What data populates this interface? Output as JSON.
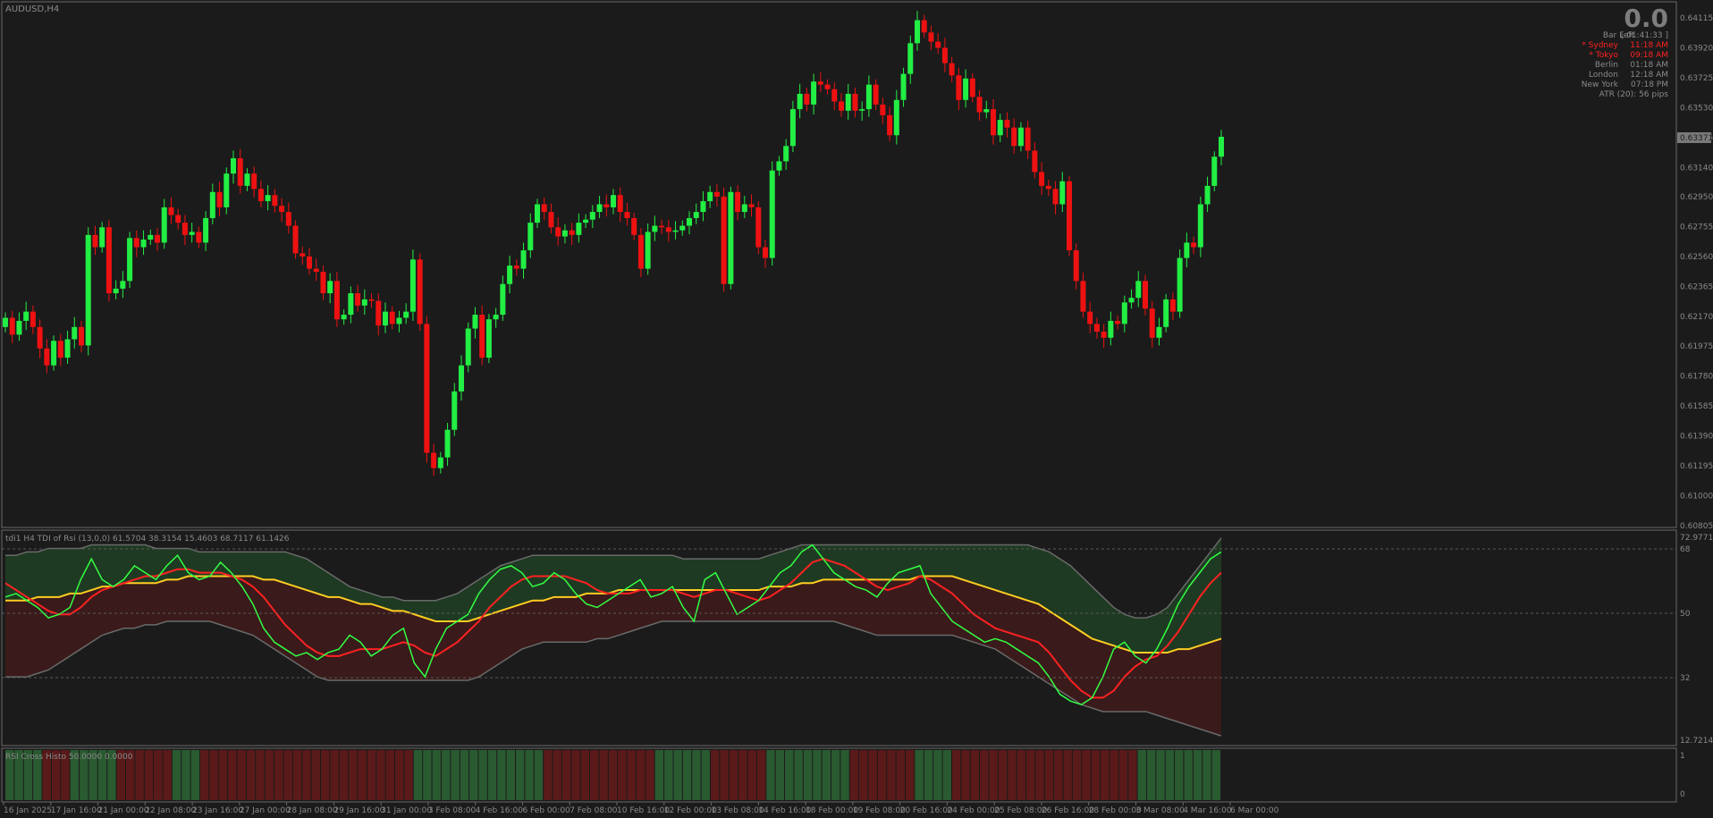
{
  "window": {
    "title": "AUDUSD,H4"
  },
  "colors": {
    "bull": "#22ee44",
    "bear": "#ee1111",
    "grid": "#5a5a5a",
    "text": "#8a8a8a",
    "background": "#1b1b1b"
  },
  "info_panel": {
    "value": "0.0",
    "rows": [
      {
        "label": "Bar Left",
        "value": "[ 01:41:33 ]",
        "highlight": false
      },
      {
        "label": "* Sydney",
        "value": "11:18 AM",
        "highlight": true
      },
      {
        "label": "* Tokyo",
        "value": "09:18 AM",
        "highlight": true
      },
      {
        "label": "Berlin",
        "value": "01:18 AM",
        "highlight": false
      },
      {
        "label": "London",
        "value": "12:18 AM",
        "highlight": false
      },
      {
        "label": "New York",
        "value": "07:18 PM",
        "highlight": false
      }
    ],
    "atr": "ATR (20): 56 pips"
  },
  "price_axis": {
    "ticks": [
      "0.64115",
      "0.63920",
      "0.63725",
      "0.63530",
      "0.63335",
      "0.63140",
      "0.62950",
      "0.62755",
      "0.62560",
      "0.62365",
      "0.62170",
      "0.61975",
      "0.61780",
      "0.61585",
      "0.61390",
      "0.61195",
      "0.61000",
      "0.60805"
    ],
    "current_price": "0.63371"
  },
  "tdi": {
    "title": "tdi1 H4 TDI of Rsi (13,0,0) 61.5704 38.3154 15.4603 68.7117 61.1426",
    "axis_labels": [
      "72.9771",
      "68",
      "50",
      "32",
      "12.7214"
    ]
  },
  "histo": {
    "title": "RSI Cross Histo 50.0000 0.0000",
    "axis_labels": [
      "1",
      "0"
    ]
  },
  "time_axis": [
    "16 Jan 2025",
    "17 Jan 16:00",
    "21 Jan 00:00",
    "22 Jan 08:00",
    "23 Jan 16:00",
    "27 Jan 00:00",
    "28 Jan 08:00",
    "29 Jan 16:00",
    "31 Jan 00:00",
    "3 Feb 08:00",
    "4 Feb 16:00",
    "6 Feb 00:00",
    "7 Feb 08:00",
    "10 Feb 16:00",
    "12 Feb 00:00",
    "13 Feb 08:00",
    "14 Feb 16:00",
    "18 Feb 00:00",
    "19 Feb 08:00",
    "20 Feb 16:00",
    "24 Feb 00:00",
    "25 Feb 08:00",
    "26 Feb 16:00",
    "28 Feb 00:00",
    "3 Mar 08:00",
    "4 Mar 16:00",
    "6 Mar 00:00"
  ],
  "chart_data": {
    "type": "candlestick",
    "symbol": "AUDUSD",
    "timeframe": "H4",
    "ylim": [
      0.60805,
      0.64115
    ],
    "closes": [
      0.6216,
      0.6205,
      0.6214,
      0.622,
      0.621,
      0.6196,
      0.6185,
      0.6201,
      0.619,
      0.6202,
      0.621,
      0.6198,
      0.627,
      0.6262,
      0.6275,
      0.6232,
      0.6235,
      0.624,
      0.6268,
      0.6262,
      0.6267,
      0.627,
      0.6265,
      0.6288,
      0.6283,
      0.6278,
      0.627,
      0.6272,
      0.6265,
      0.6281,
      0.6298,
      0.6288,
      0.631,
      0.632,
      0.6302,
      0.631,
      0.63,
      0.6292,
      0.6296,
      0.6289,
      0.6285,
      0.6276,
      0.6258,
      0.6256,
      0.6248,
      0.6246,
      0.6232,
      0.624,
      0.6215,
      0.6218,
      0.6232,
      0.6224,
      0.6228,
      0.6227,
      0.6211,
      0.622,
      0.6212,
      0.6216,
      0.622,
      0.6254,
      0.6212,
      0.6128,
      0.6118,
      0.6125,
      0.6143,
      0.6168,
      0.6185,
      0.6209,
      0.6218,
      0.619,
      0.6215,
      0.6218,
      0.6238,
      0.625,
      0.6248,
      0.626,
      0.6278,
      0.629,
      0.6285,
      0.6275,
      0.6269,
      0.6273,
      0.627,
      0.6278,
      0.628,
      0.6285,
      0.629,
      0.6288,
      0.6296,
      0.6285,
      0.6281,
      0.627,
      0.6248,
      0.6272,
      0.6276,
      0.6275,
      0.6272,
      0.6273,
      0.6276,
      0.6281,
      0.6285,
      0.6292,
      0.6298,
      0.6295,
      0.6238,
      0.6298,
      0.6285,
      0.629,
      0.6288,
      0.6262,
      0.6255,
      0.6312,
      0.6318,
      0.6328,
      0.6352,
      0.6362,
      0.6355,
      0.637,
      0.6368,
      0.6365,
      0.6357,
      0.6351,
      0.6362,
      0.6351,
      0.6352,
      0.6368,
      0.6355,
      0.6348,
      0.6335,
      0.6358,
      0.6375,
      0.6395,
      0.641,
      0.6402,
      0.6396,
      0.6392,
      0.6382,
      0.6374,
      0.6358,
      0.6372,
      0.636,
      0.635,
      0.6352,
      0.6335,
      0.6345,
      0.634,
      0.6328,
      0.634,
      0.6325,
      0.6311,
      0.6302,
      0.63,
      0.629,
      0.6305,
      0.626,
      0.624,
      0.622,
      0.6212,
      0.6207,
      0.6203,
      0.6214,
      0.6212,
      0.6226,
      0.6229,
      0.624,
      0.6222,
      0.6203,
      0.621,
      0.6228,
      0.622,
      0.6255,
      0.6265,
      0.6262,
      0.629,
      0.6302,
      0.6321,
      0.6334
    ],
    "tdi": {
      "rsi_price_line": [
        55,
        56,
        54,
        52,
        49,
        50,
        52,
        60,
        66,
        60,
        58,
        60,
        64,
        62,
        60,
        64,
        67,
        62,
        60,
        61,
        65,
        62,
        58,
        53,
        46,
        42,
        40,
        38,
        39,
        37,
        39,
        40,
        44,
        42,
        38,
        40,
        44,
        46,
        36,
        32,
        40,
        46,
        48,
        50,
        56,
        60,
        63,
        64,
        62,
        58,
        59,
        62,
        60,
        56,
        53,
        52,
        54,
        56,
        58,
        60,
        55,
        56,
        58,
        52,
        48,
        60,
        62,
        56,
        50,
        52,
        54,
        58,
        62,
        64,
        68,
        70,
        66,
        62,
        60,
        58,
        57,
        55,
        59,
        62,
        63,
        64,
        56,
        52,
        48,
        46,
        44,
        42,
        43,
        42,
        40,
        38,
        36,
        32,
        27,
        25,
        24,
        26,
        32,
        40,
        42,
        38,
        36,
        40,
        46,
        53,
        58,
        62,
        66,
        68
      ],
      "trade_signal_line": [
        59,
        57,
        55,
        53,
        51,
        50,
        50,
        52,
        55,
        57,
        58,
        59,
        60,
        61,
        61,
        62,
        63,
        63,
        62,
        62,
        62,
        61,
        60,
        58,
        55,
        51,
        47,
        44,
        41,
        39,
        38,
        38,
        39,
        40,
        40,
        40,
        41,
        42,
        41,
        39,
        38,
        40,
        42,
        45,
        48,
        52,
        55,
        58,
        60,
        61,
        61,
        61,
        61,
        60,
        59,
        57,
        56,
        56,
        56,
        57,
        57,
        57,
        57,
        56,
        55,
        56,
        57,
        57,
        56,
        55,
        54,
        55,
        57,
        59,
        62,
        65,
        66,
        65,
        64,
        62,
        60,
        58,
        57,
        58,
        59,
        61,
        60,
        58,
        56,
        53,
        50,
        48,
        46,
        45,
        44,
        43,
        42,
        39,
        35,
        31,
        28,
        26,
        26,
        28,
        32,
        35,
        37,
        38,
        41,
        45,
        50,
        55,
        59,
        62
      ],
      "market_base_line": [
        54,
        54,
        54,
        55,
        55,
        55,
        56,
        56,
        57,
        58,
        58,
        59,
        59,
        59,
        59,
        60,
        60,
        61,
        61,
        61,
        61,
        61,
        61,
        61,
        60,
        60,
        59,
        58,
        57,
        56,
        55,
        55,
        54,
        53,
        53,
        52,
        51,
        51,
        50,
        49,
        48,
        48,
        48,
        48,
        49,
        50,
        51,
        52,
        53,
        54,
        54,
        55,
        55,
        55,
        56,
        56,
        56,
        57,
        57,
        57,
        57,
        57,
        57,
        57,
        57,
        57,
        57,
        57,
        57,
        57,
        57,
        58,
        58,
        58,
        59,
        59,
        60,
        60,
        60,
        60,
        60,
        60,
        60,
        60,
        60,
        61,
        61,
        61,
        61,
        60,
        59,
        58,
        57,
        56,
        55,
        54,
        53,
        51,
        49,
        47,
        45,
        43,
        42,
        41,
        40,
        39,
        39,
        39,
        39,
        40,
        40,
        41,
        42,
        43
      ],
      "volatility_band_upper": [
        67,
        67,
        68,
        68,
        69,
        69,
        69,
        69,
        70,
        70,
        70,
        70,
        70,
        70,
        69,
        69,
        69,
        69,
        68,
        68,
        68,
        68,
        68,
        68,
        68,
        68,
        68,
        67,
        66,
        64,
        62,
        60,
        58,
        57,
        56,
        55,
        55,
        54,
        54,
        54,
        54,
        55,
        56,
        58,
        60,
        62,
        64,
        65,
        66,
        67,
        67,
        67,
        67,
        67,
        67,
        67,
        67,
        67,
        67,
        67,
        67,
        67,
        67,
        66,
        66,
        66,
        66,
        66,
        66,
        66,
        66,
        67,
        68,
        69,
        70,
        70,
        70,
        70,
        70,
        70,
        70,
        70,
        70,
        70,
        70,
        70,
        70,
        70,
        70,
        70,
        70,
        70,
        70,
        70,
        70,
        70,
        69,
        68,
        66,
        64,
        61,
        58,
        55,
        52,
        50,
        49,
        49,
        50,
        52,
        56,
        60,
        64,
        68,
        72
      ],
      "volatility_band_lower": [
        32,
        32,
        32,
        33,
        34,
        36,
        38,
        40,
        42,
        44,
        45,
        46,
        46,
        47,
        47,
        48,
        48,
        48,
        48,
        48,
        47,
        46,
        45,
        44,
        42,
        40,
        38,
        36,
        34,
        32,
        31,
        31,
        31,
        31,
        31,
        31,
        31,
        31,
        31,
        31,
        31,
        31,
        31,
        31,
        32,
        34,
        36,
        38,
        40,
        41,
        42,
        42,
        42,
        42,
        42,
        43,
        43,
        44,
        45,
        46,
        47,
        48,
        48,
        48,
        48,
        48,
        48,
        48,
        48,
        48,
        48,
        48,
        48,
        48,
        48,
        48,
        48,
        48,
        47,
        46,
        45,
        44,
        44,
        44,
        44,
        44,
        44,
        44,
        44,
        43,
        42,
        41,
        40,
        38,
        36,
        34,
        32,
        30,
        28,
        26,
        24,
        23,
        22,
        22,
        22,
        22,
        22,
        21,
        20,
        19,
        18,
        17,
        16,
        15
      ]
    },
    "rsi_cross_histo": "1,1,1,1,0,0,0,1,1,1,1,1,0,0,0,0,0,0,1,1,1,0,0,0,0,0,0,0,0,0,0,0,0,0,0,0,0,0,0,0,0,0,0,0,1,1,1,1,1,1,1,1,1,1,1,1,1,1,0,0,0,0,0,0,0,0,0,0,0,0,1,1,1,1,1,1,0,0,0,0,0,0,1,1,1,1,1,1,1,1,1,0,0,0,0,0,0,0,1,1,1,1,0,0,0,0,0,0,0,0,0,0,0,0,0,0,0,0,0,0,0,0,1,1,1,1,1,1,1,1,1"
  }
}
